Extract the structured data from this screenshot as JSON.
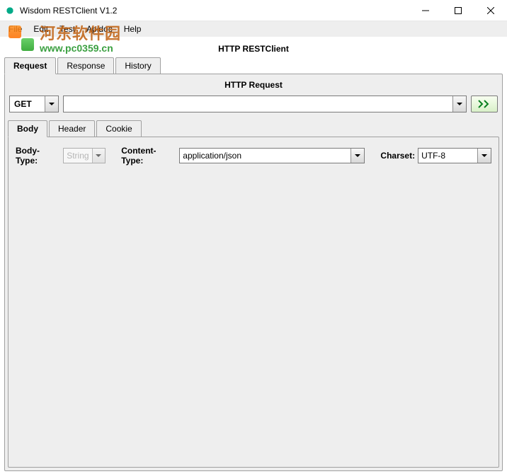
{
  "window": {
    "title": "Wisdom RESTClient V1.2"
  },
  "watermark": {
    "line1": "河东软件园",
    "line2": "www.pc0359.cn"
  },
  "menu": {
    "items": [
      "File",
      "Edit",
      "Test",
      "Apidoc",
      "Help"
    ]
  },
  "app": {
    "title": "HTTP RESTClient"
  },
  "mainTabs": {
    "items": [
      "Request",
      "Response",
      "History"
    ],
    "active": 0
  },
  "request": {
    "section_title": "HTTP Request",
    "method": "GET",
    "url": "",
    "tabs": {
      "items": [
        "Body",
        "Header",
        "Cookie"
      ],
      "active": 0
    },
    "body": {
      "body_type_label": "Body-Type:",
      "body_type_value": "String",
      "content_type_label": "Content-Type:",
      "content_type_value": "application/json",
      "charset_label": "Charset:",
      "charset_value": "UTF-8"
    }
  }
}
